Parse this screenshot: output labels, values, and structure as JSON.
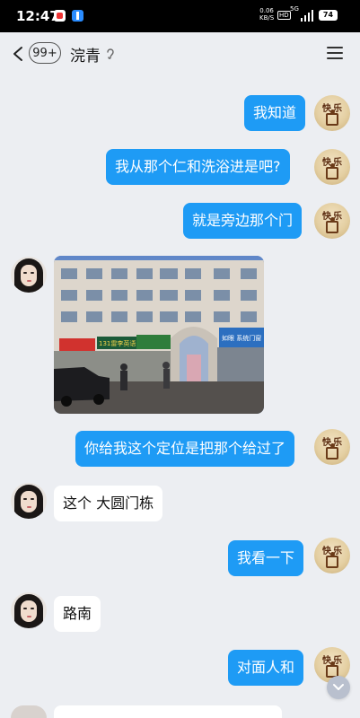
{
  "status_bar": {
    "time": "12:47",
    "net_speed": "0.06",
    "net_unit": "KB/S",
    "hd": "HD",
    "network": "5G",
    "battery": "74"
  },
  "header": {
    "unread_count": "99+",
    "contact_name": "浣青",
    "back_icon": "chevron-left-icon",
    "ear_icon": "earpiece-mode-icon",
    "menu_icon": "hamburger-menu-icon"
  },
  "messages": [
    {
      "sender": "me",
      "type": "text",
      "text": "我知道"
    },
    {
      "sender": "me",
      "type": "text",
      "text": "我从那个仁和洗浴进是吧?"
    },
    {
      "sender": "me",
      "type": "text",
      "text": "就是旁边那个门"
    },
    {
      "sender": "other",
      "type": "image",
      "sign_left": "131雷李英语",
      "sign_right": "如眼 系统门窗"
    },
    {
      "sender": "me",
      "type": "text",
      "text": "你给我这个定位是把那个给过了"
    },
    {
      "sender": "other",
      "type": "text",
      "text": "这个 大圆门栋"
    },
    {
      "sender": "me",
      "type": "text",
      "text": "我看一下"
    },
    {
      "sender": "other",
      "type": "text",
      "text": "路南"
    },
    {
      "sender": "me",
      "type": "text",
      "text": "对面人和"
    }
  ],
  "my_avatar": {
    "text1": "快",
    "text2": "乐"
  },
  "colors": {
    "outgoing_bubble": "#1e9bf5",
    "incoming_bubble": "#ffffff",
    "background": "#eceef2"
  }
}
